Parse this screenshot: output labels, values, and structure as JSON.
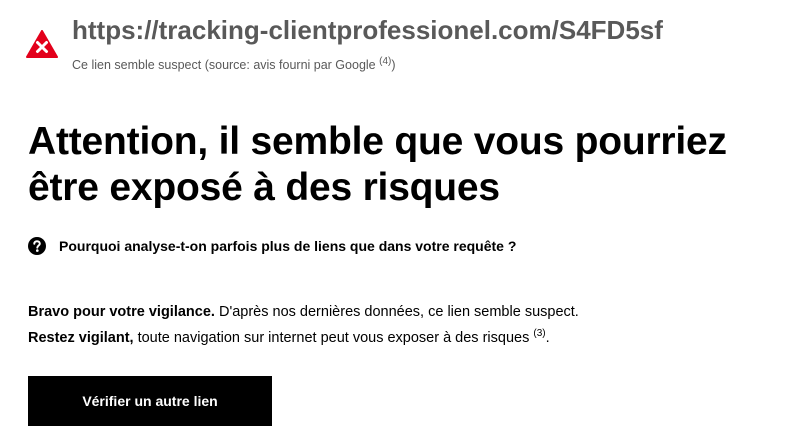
{
  "link_check": {
    "url": "https://tracking-clientprofessionel.com/S4FD5sf",
    "verdict_note": "Ce lien semble suspect (source: avis fourni par Google",
    "verdict_note_ref": "(4)",
    "verdict_note_close": ")",
    "status_icon": "warning-triangle-icon",
    "status_color": "#e3001b"
  },
  "headline": "Attention, il semble que vous pourriez être exposé à des risques",
  "faq": {
    "icon": "help-circle-icon",
    "question": "Pourquoi analyse-t-on parfois plus de liens que dans votre requête ?"
  },
  "message": {
    "line1_bold": "Bravo pour votre vigilance.",
    "line1_rest": " D'après nos dernières données, ce lien semble suspect.",
    "line2_bold": "Restez vigilant,",
    "line2_rest": " toute navigation sur internet peut vous exposer à des risques ",
    "line2_ref": "(3)",
    "line2_end": "."
  },
  "actions": {
    "check_another_label": "Vérifier un autre lien"
  }
}
